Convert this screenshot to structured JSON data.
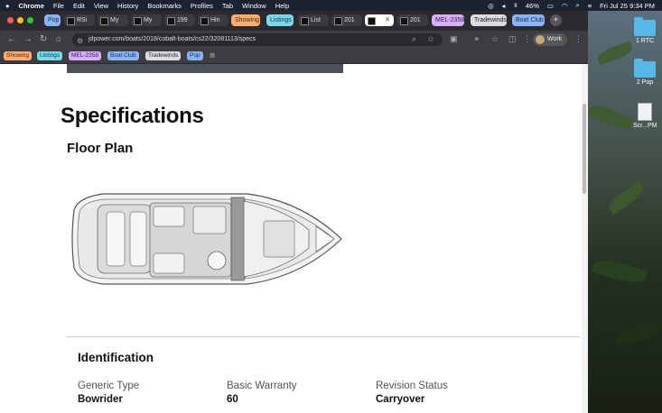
{
  "menubar": {
    "apple": "",
    "app": "Chrome",
    "items": [
      "File",
      "Edit",
      "View",
      "History",
      "Bookmarks",
      "Profiles",
      "Tab",
      "Window",
      "Help"
    ],
    "battery": "46%",
    "clock": "Fri Jul 25  9:34 PM"
  },
  "tabs": {
    "items": [
      {
        "label": "Pop",
        "kind": "group"
      },
      {
        "label": "RSi",
        "kind": "page"
      },
      {
        "label": "My",
        "kind": "page"
      },
      {
        "label": "My",
        "kind": "page"
      },
      {
        "label": "199",
        "kind": "page"
      },
      {
        "label": "Hin",
        "kind": "page"
      },
      {
        "label": "Showing",
        "kind": "group"
      },
      {
        "label": "Listings",
        "kind": "group"
      },
      {
        "label": "List",
        "kind": "page"
      },
      {
        "label": "201",
        "kind": "page"
      },
      {
        "label": "",
        "kind": "active"
      },
      {
        "label": "201",
        "kind": "page"
      },
      {
        "label": "MEL-2358",
        "kind": "group"
      },
      {
        "label": "Tradewinds",
        "kind": "group"
      },
      {
        "label": "Boat Club",
        "kind": "group"
      }
    ],
    "close": "✕",
    "add": "+"
  },
  "toolbar": {
    "url": "jdpower.com/boats/2018/cobalt-boats/cs22/32081113/specs",
    "profile": "Work"
  },
  "bookmarks": {
    "items": [
      "Showing",
      "Listings",
      "MEL-2358",
      "Boat Club",
      "Tradewinds",
      "Pop"
    ]
  },
  "page": {
    "title": "Specifications",
    "floor_plan_title": "Floor Plan",
    "identification_title": "Identification",
    "fields": [
      {
        "label": "Generic Type",
        "value": "Bowrider"
      },
      {
        "label": "Basic Warranty",
        "value": "60"
      },
      {
        "label": "Revision Status",
        "value": "Carryover"
      }
    ]
  },
  "desktop": {
    "icons": [
      {
        "label": "1 RTC",
        "type": "folder"
      },
      {
        "label": "2 Pop",
        "type": "folder"
      },
      {
        "label": "Scr...PM",
        "type": "file"
      }
    ]
  },
  "colors": {
    "Pop": "#8ab4f8",
    "Showing": "#fcad70",
    "Listings": "#78d9ec",
    "MEL-2358": "#d7aefb",
    "Tradewinds": "#dadce0",
    "Boat Club": "#8ab4f8"
  }
}
